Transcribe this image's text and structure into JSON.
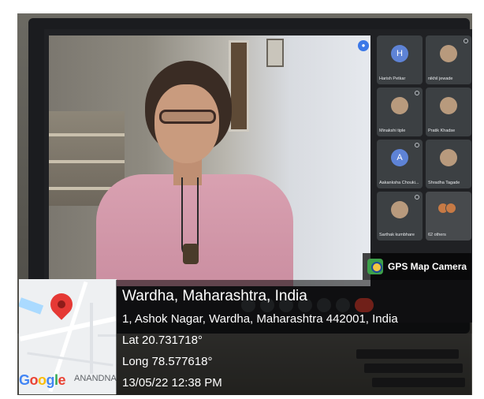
{
  "meeting": {
    "speaker_mic_icon": "mic-active-icon",
    "participants": [
      {
        "name": "Harish Petkar",
        "avatar": "H",
        "kind": "initial"
      },
      {
        "name": "nikhil jewade",
        "avatar": "",
        "kind": "photo"
      },
      {
        "name": "Minakshi tiple",
        "avatar": "",
        "kind": "photo"
      },
      {
        "name": "Pratik Khadse",
        "avatar": "",
        "kind": "photo"
      },
      {
        "name": "Aakanksha Chouki...",
        "avatar": "A",
        "kind": "initial"
      },
      {
        "name": "Shradha Tagade",
        "avatar": "",
        "kind": "photo"
      },
      {
        "name": "Sarthak kumbhare",
        "avatar": "",
        "kind": "photo"
      },
      {
        "name": "62 others",
        "avatar": "",
        "kind": "others"
      }
    ],
    "control_icons": [
      "more-options-icon",
      "raise-hand-icon",
      "present-icon",
      "captions-icon",
      "camera-icon",
      "mic-icon",
      "end-call-icon"
    ]
  },
  "gps": {
    "badge_label": "GPS Map Camera",
    "location_title": "Wardha, Maharashtra, India",
    "address": "1, Ashok Nagar, Wardha, Maharashtra 442001, India",
    "lat": "Lat 20.731718°",
    "long": "Long 78.577618°",
    "timestamp": "13/05/22 12:38 PM"
  },
  "map": {
    "logo": [
      "G",
      "o",
      "o",
      "g",
      "l",
      "e"
    ],
    "area_label": "ANANDNA",
    "pin_color": "#e53935"
  }
}
